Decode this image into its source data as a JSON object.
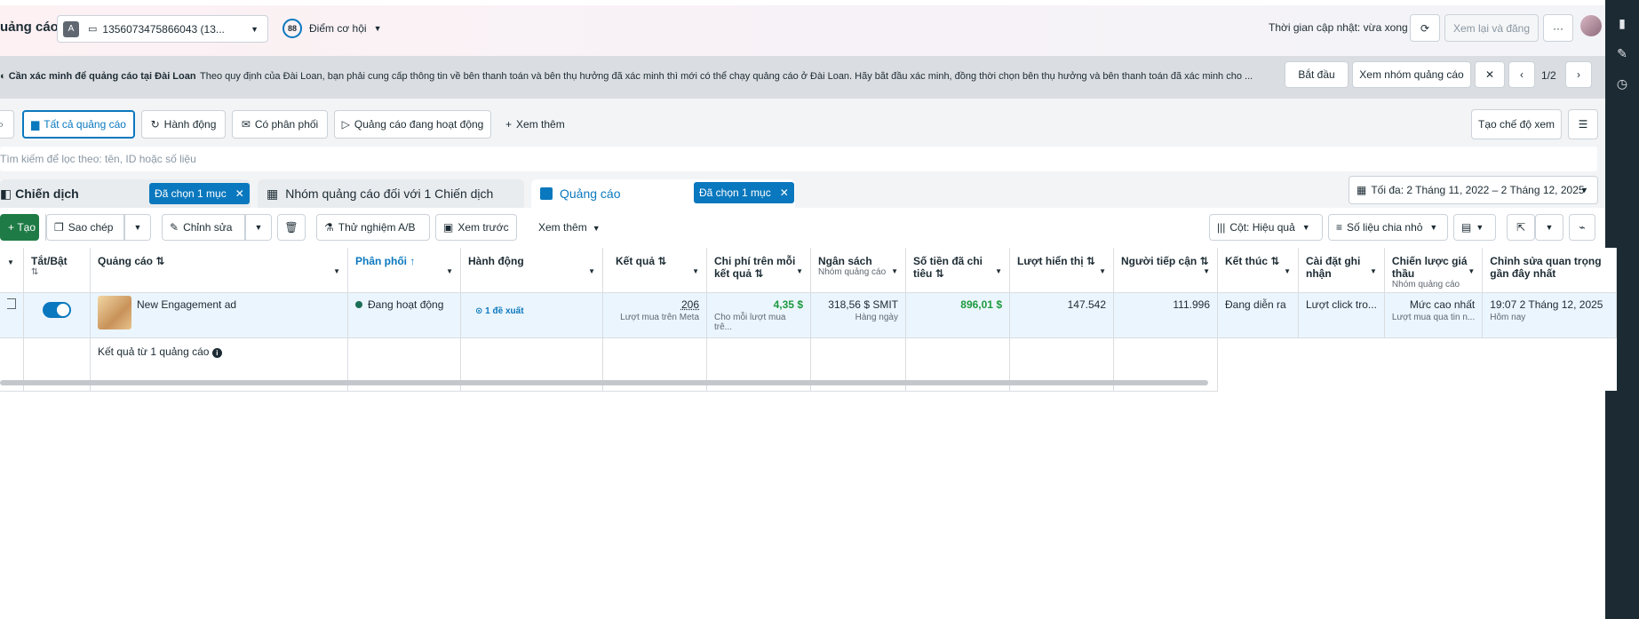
{
  "header": {
    "title": "uảng cáo",
    "account_letter": "A",
    "account_id": "1356073475866043 (13...",
    "score": "88",
    "score_label": "Điểm cơ hội",
    "update_time": "Thời gian cập nhật: vừa xong",
    "review_publish": "Xem lại và đăng",
    "more": "···"
  },
  "notice": {
    "title": "Cần xác minh để quảng cáo tại Đài Loan",
    "body": "Theo quy định của Đài Loan, bạn phải cung cấp thông tin về bên thanh toán và bên thụ hưởng đã xác minh thì mới có thể chạy quảng cáo ở Đài Loan. Hãy bắt đầu xác minh, đồng thời chọn bên thụ hưởng và bên thanh toán đã xác minh cho ...",
    "start": "Bắt đầu",
    "view_group": "Xem nhóm quảng cáo",
    "pager": "1/2"
  },
  "filters": {
    "all_ads": "Tất cả quảng cáo",
    "actions": "Hành động",
    "delivering": "Có phân phối",
    "active_ads": "Quảng cáo đang hoạt động",
    "see_more": "Xem thêm",
    "create_view": "Tạo chế độ xem"
  },
  "search": {
    "placeholder": "Tìm kiếm để lọc theo: tên, ID hoặc số liệu"
  },
  "tabs": {
    "campaign": "Chiến dịch",
    "campaign_chip": "Đã chọn 1 mục",
    "adset": "Nhóm quảng cáo đối với 1 Chiến dịch",
    "ads": "Quảng cáo",
    "ads_chip": "Đã chọn 1 mục",
    "date_range": "Tối đa: 2 Tháng 11, 2022 – 2 Tháng 12, 2025"
  },
  "toolbar": {
    "create": "Tạo",
    "duplicate": "Sao chép",
    "edit": "Chỉnh sửa",
    "ab_test": "Thử nghiệm A/B",
    "preview": "Xem trước",
    "more": "Xem thêm",
    "columns": "Cột: Hiệu quả",
    "breakdown": "Số liệu chia nhỏ"
  },
  "table": {
    "headers": {
      "toggle": "Tắt/Bật",
      "ad": "Quảng cáo",
      "delivery": "Phân phối",
      "actions": "Hành động",
      "results": "Kết quả",
      "cost_per_result": "Chi phí trên mỗi kết quả",
      "budget": "Ngân sách",
      "budget_sub": "Nhóm quảng cáo",
      "amount_spent": "Số tiền đã chi tiêu",
      "impressions": "Lượt hiển thị",
      "reach": "Người tiếp cận",
      "ends": "Kết thúc",
      "attribution": "Cài đặt ghi nhận",
      "bid_strategy": "Chiến lược giá thầu",
      "bid_strategy_sub": "Nhóm quảng cáo",
      "last_edit": "Chỉnh sửa quan trọng gần đây nhất"
    },
    "row": {
      "name": "New Engagement ad",
      "delivery": "Đang hoạt động",
      "actions": "1 đề xuất",
      "results": "206",
      "results_sub": "Lượt mua trên Meta",
      "cost": "4,35 $",
      "cost_sub": "Cho mỗi lượt mua trê...",
      "budget": "318,56 $ SMIT",
      "budget_sub": "Hàng ngày",
      "spent": "896,01 $",
      "impressions": "147.542",
      "reach": "111.996",
      "ends": "Đang diễn ra",
      "attribution": "Lượt click tro...",
      "bid": "Mức cao nhất",
      "bid_sub": "Lượt mua qua tin n...",
      "edited": "19:07 2 Tháng 12, 2025",
      "edited_sub": "Hôm nay"
    },
    "summary": "Kết quả từ 1 quảng cáo"
  },
  "colors": {
    "primary": "#0a78be",
    "create_green": "#1e7b45",
    "rail": "#1c2b33"
  }
}
